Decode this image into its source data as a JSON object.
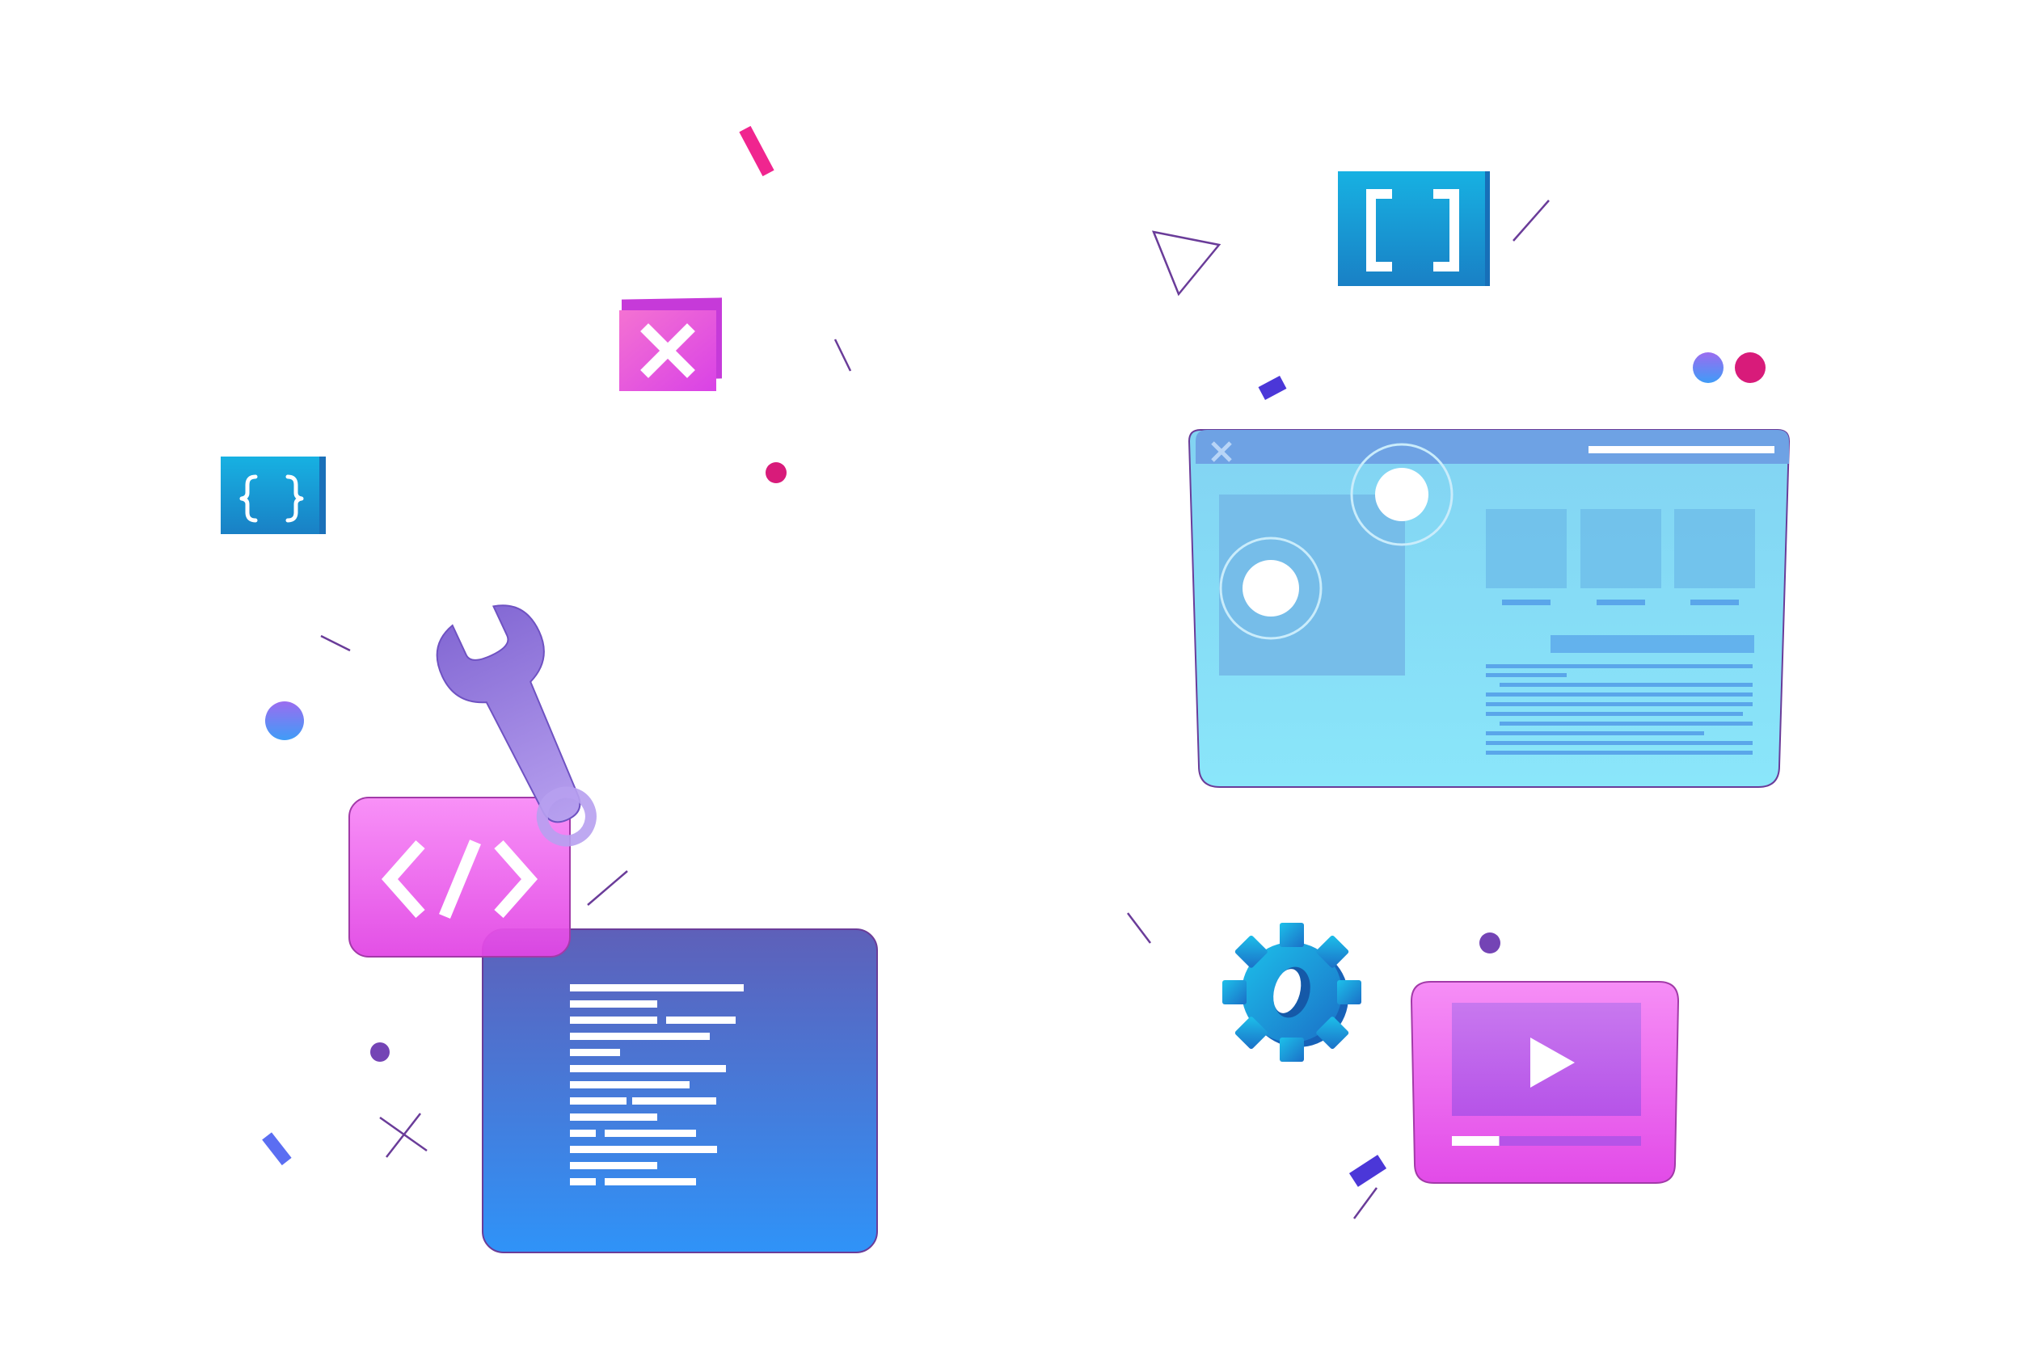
{
  "illustration": {
    "theme": "web development",
    "colors": {
      "pink": "#e64be6",
      "pink_light": "#f77ff5",
      "magenta_dot": "#d81b7a",
      "blue_dark": "#4e73d8",
      "blue_bright": "#2f8ff7",
      "indigo": "#5b5bb5",
      "cyan": "#16a6d8",
      "cyan_dark": "#1a7fc4",
      "light_blue": "#8ae2f7",
      "lavender": "#8d7ae6",
      "purple_line": "#6a3c99"
    },
    "icons": [
      "code-brackets-icon",
      "curly-braces-icon",
      "square-brackets-icon",
      "close-x-icon",
      "wrench-icon",
      "gear-icon",
      "play-icon"
    ],
    "video_player": {
      "progress": 0.25
    }
  }
}
